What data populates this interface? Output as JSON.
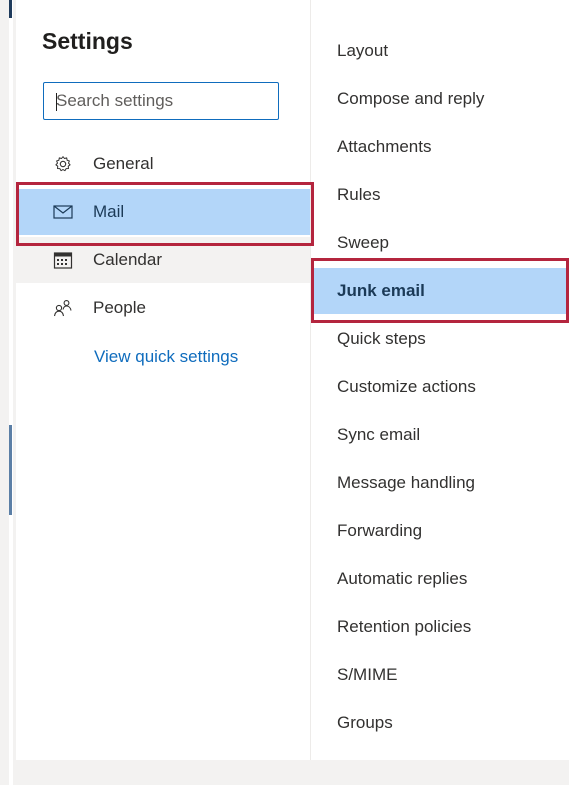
{
  "settings": {
    "title": "Settings",
    "search_placeholder": "Search settings",
    "nav": [
      {
        "label": "General",
        "icon": "gear-icon"
      },
      {
        "label": "Mail",
        "icon": "mail-icon",
        "selected": true
      },
      {
        "label": "Calendar",
        "icon": "calendar-icon"
      },
      {
        "label": "People",
        "icon": "people-icon"
      }
    ],
    "view_quick_settings": "View quick settings"
  },
  "mail_settings": {
    "items": [
      "Layout",
      "Compose and reply",
      "Attachments",
      "Rules",
      "Sweep",
      "Junk email",
      "Quick steps",
      "Customize actions",
      "Sync email",
      "Message handling",
      "Forwarding",
      "Automatic replies",
      "Retention policies",
      "S/MIME",
      "Groups"
    ],
    "selected": "Junk email"
  },
  "colors": {
    "accent": "#0f6cbd",
    "selection": "#b3d6f9",
    "highlight_border": "#b4253e"
  }
}
